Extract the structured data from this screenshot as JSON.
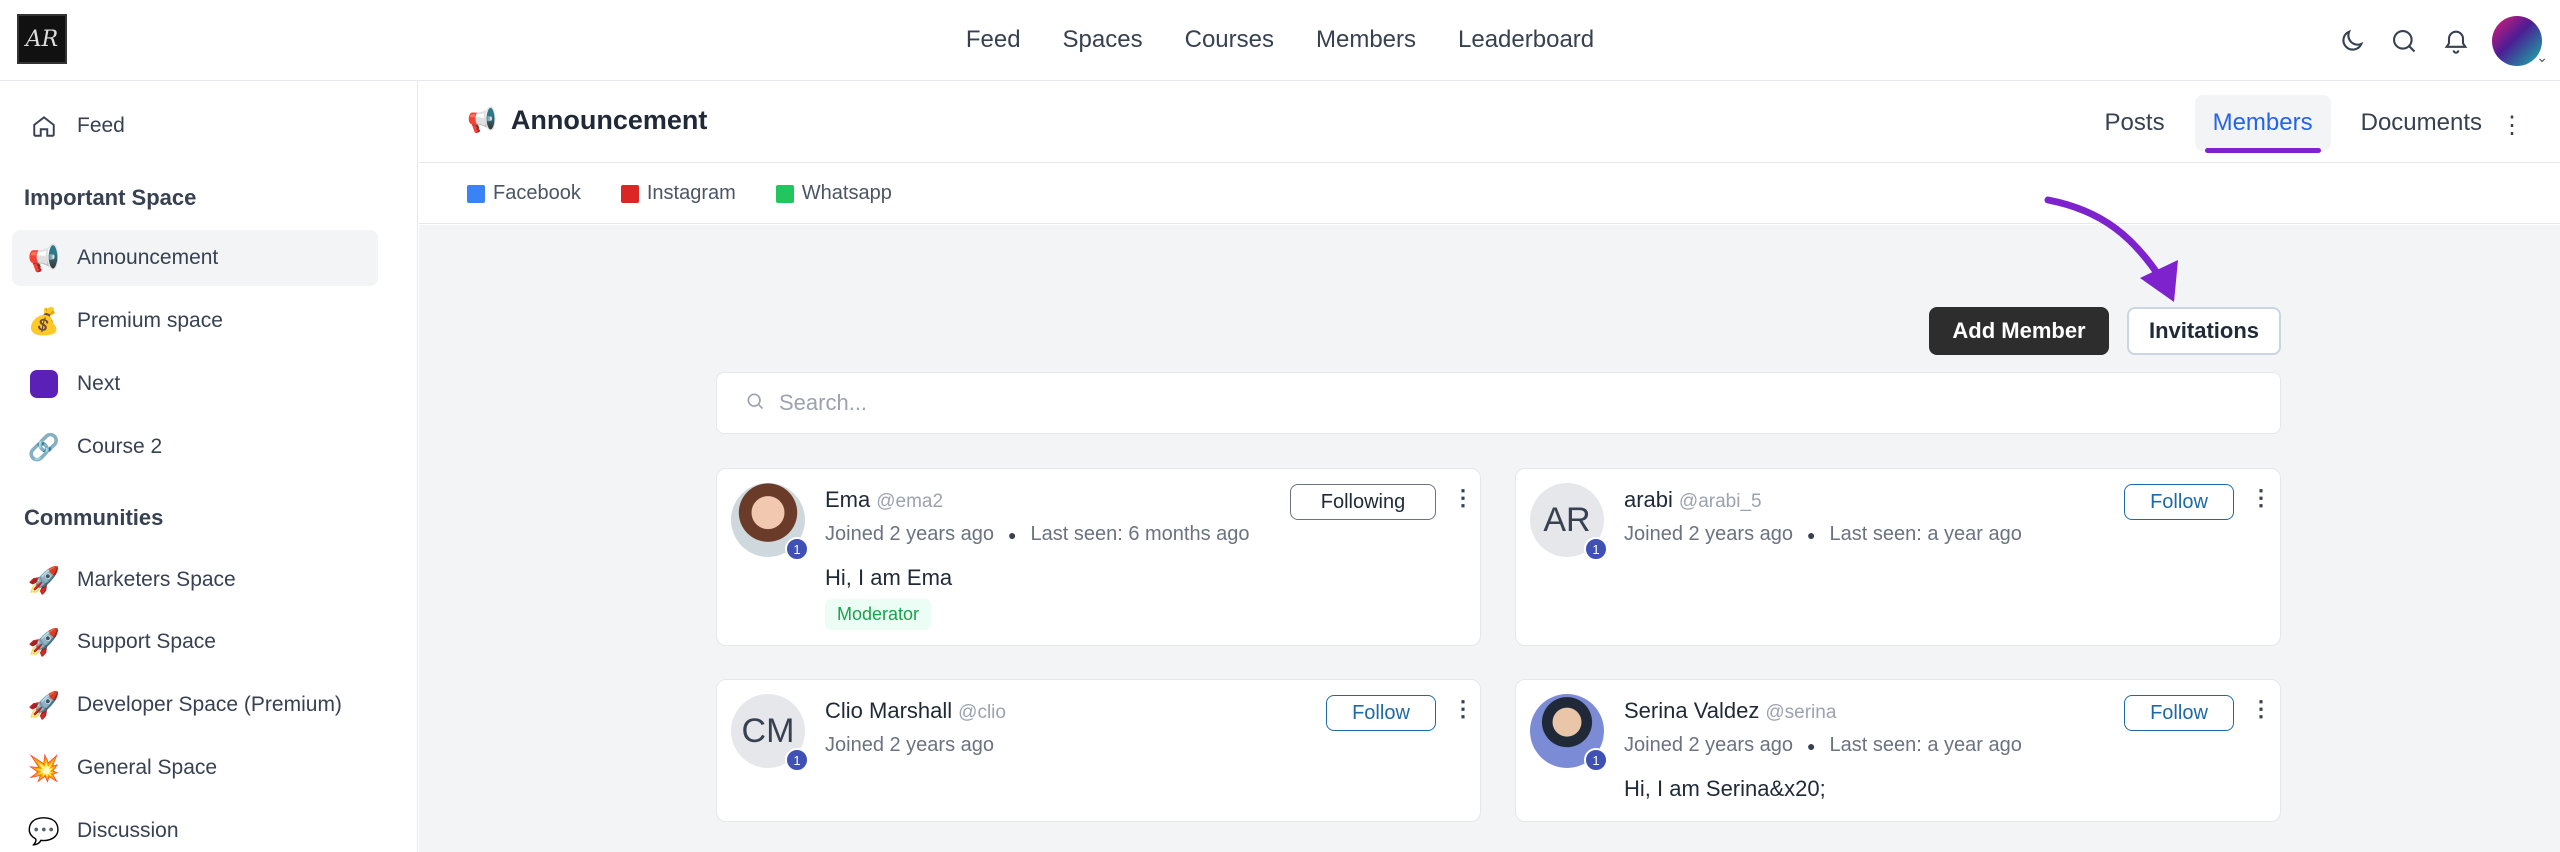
{
  "topnav": [
    "Feed",
    "Spaces",
    "Courses",
    "Members",
    "Leaderboard"
  ],
  "logo_text": "AR",
  "sidebar": {
    "feed_label": "Feed",
    "section1_title": "Important Space",
    "section1_items": [
      {
        "label": "Announcement",
        "icon": "megaphone"
      },
      {
        "label": "Premium space",
        "icon": "money-bag"
      },
      {
        "label": "Next",
        "icon": "purple-square"
      },
      {
        "label": "Course 2",
        "icon": "link"
      }
    ],
    "section2_title": "Communities",
    "section2_items": [
      {
        "label": "Marketers Space",
        "icon": "rocket"
      },
      {
        "label": "Support Space",
        "icon": "rocket"
      },
      {
        "label": "Developer Space (Premium)",
        "icon": "rocket"
      },
      {
        "label": "General Space",
        "icon": "collision"
      },
      {
        "label": "Discussion",
        "icon": "speech-bubble"
      }
    ]
  },
  "space": {
    "title": "Announcement",
    "tabs": [
      "Posts",
      "Members",
      "Documents"
    ],
    "active_tab": "Members",
    "links": [
      {
        "label": "Facebook",
        "color": "#3b82f6"
      },
      {
        "label": "Instagram",
        "color": "#dc2626"
      },
      {
        "label": "Whatsapp",
        "color": "#22c55e"
      }
    ]
  },
  "actions": {
    "add_member": "Add Member",
    "invitations": "Invitations"
  },
  "search": {
    "placeholder": "Search..."
  },
  "members": [
    {
      "name": "Ema",
      "handle": "@ema2",
      "joined": "Joined 2 years ago",
      "last_seen": "Last seen: 6 months ago",
      "bio": "Hi, I am Ema",
      "role": "Moderator",
      "follow": "Following",
      "level": "1"
    },
    {
      "name": "arabi",
      "handle": "@arabi_5",
      "joined": "Joined 2 years ago",
      "last_seen": "Last seen: a year ago",
      "initials": "AR",
      "follow": "Follow",
      "level": "1"
    },
    {
      "name": "Clio Marshall",
      "handle": "@clio",
      "joined": "Joined 2 years ago",
      "initials": "CM",
      "follow": "Follow",
      "level": "1"
    },
    {
      "name": "Serina Valdez",
      "handle": "@serina",
      "joined": "Joined 2 years ago",
      "last_seen": "Last seen: a year ago",
      "bio": "Hi, I am Serina&x20;",
      "follow": "Follow",
      "level": "1"
    }
  ],
  "colors": {
    "accent_purple": "#7e22ce",
    "tab_blue": "#2563eb",
    "follow_blue": "#1e6aa8"
  }
}
